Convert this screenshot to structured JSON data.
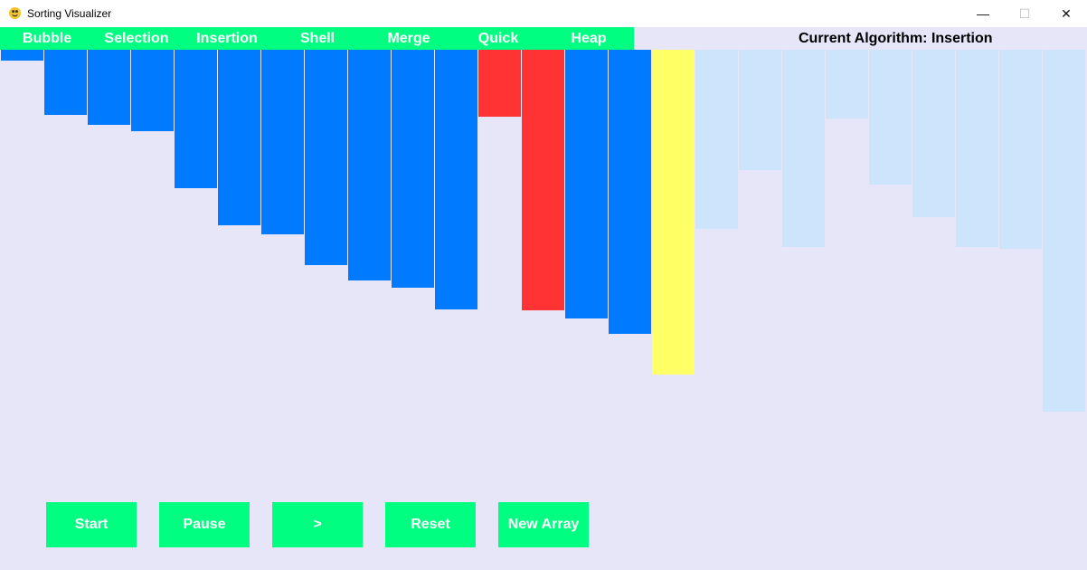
{
  "window": {
    "title": "Sorting Visualizer",
    "minimize_glyph": "—",
    "maximize_glyph": "☐",
    "close_glyph": "✕"
  },
  "menu": {
    "items": [
      {
        "label": "Bubble"
      },
      {
        "label": "Selection"
      },
      {
        "label": "Insertion"
      },
      {
        "label": "Shell"
      },
      {
        "label": "Merge"
      },
      {
        "label": "Quick"
      },
      {
        "label": "Heap"
      }
    ]
  },
  "status": {
    "current_algorithm_label": "Current Algorithm: Insertion"
  },
  "controls": {
    "start": "Start",
    "pause": "Pause",
    "step": ">",
    "reset": "Reset",
    "new_array": "New Array"
  },
  "colors": {
    "background": "#e6e6f8",
    "accent": "#00ff80",
    "bar_sorted": "#007bff",
    "bar_compare": "#ff3333",
    "bar_current": "#ffff66",
    "bar_unsorted": "#cce4fc"
  },
  "chart_data": {
    "type": "bar",
    "values": [
      12,
      72,
      83,
      90,
      153,
      194,
      204,
      238,
      255,
      263,
      287,
      74,
      288,
      297,
      314,
      359,
      198,
      133,
      218,
      76,
      149,
      185,
      218,
      220,
      400
    ],
    "states": [
      "sorted",
      "sorted",
      "sorted",
      "sorted",
      "sorted",
      "sorted",
      "sorted",
      "sorted",
      "sorted",
      "sorted",
      "sorted",
      "compare",
      "compare",
      "sorted",
      "sorted",
      "current",
      "unsorted",
      "unsorted",
      "unsorted",
      "unsorted",
      "unsorted",
      "unsorted",
      "unsorted",
      "unsorted",
      "unsorted"
    ],
    "orientation": "top-down"
  }
}
